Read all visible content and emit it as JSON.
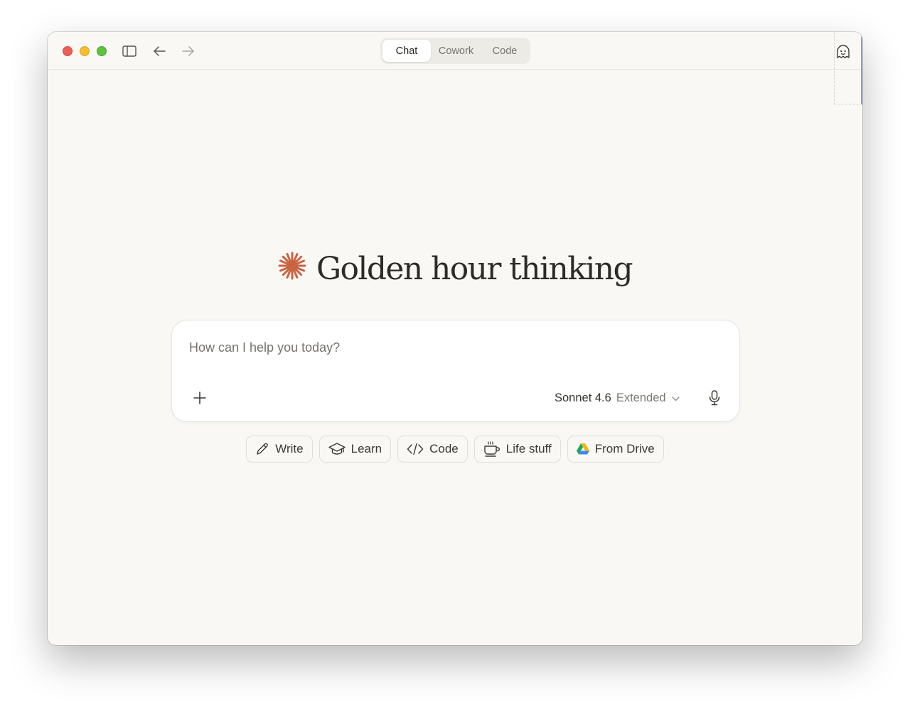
{
  "titlebar": {
    "tabs": [
      {
        "label": "Chat",
        "active": true
      },
      {
        "label": "Cowork",
        "active": false
      },
      {
        "label": "Code",
        "active": false
      }
    ],
    "icons": [
      "sidebar-toggle-icon",
      "back-arrow-icon",
      "forward-arrow-icon",
      "ghost-icon"
    ]
  },
  "hero": {
    "logo_icon": "sparkle-icon",
    "logo_color": "#c96442",
    "title": "Golden hour thinking"
  },
  "composer": {
    "placeholder": "How can I help you today?",
    "value": "",
    "model_name": "Sonnet 4.6",
    "model_mode": "Extended",
    "icons": [
      "plus-icon",
      "chevron-down-icon",
      "microphone-icon"
    ]
  },
  "chips": [
    {
      "label": "Write",
      "icon": "pencil-icon"
    },
    {
      "label": "Learn",
      "icon": "graduation-cap-icon"
    },
    {
      "label": "Code",
      "icon": "code-icon"
    },
    {
      "label": "Life stuff",
      "icon": "coffee-cup-icon"
    },
    {
      "label": "From Drive",
      "icon": "google-drive-icon"
    }
  ],
  "colors": {
    "window_bg": "#f9f8f5",
    "accent": "#c96442",
    "traffic_close": "#ec5f57",
    "traffic_minimize": "#f4bd33",
    "traffic_maximize": "#5cc23f"
  }
}
